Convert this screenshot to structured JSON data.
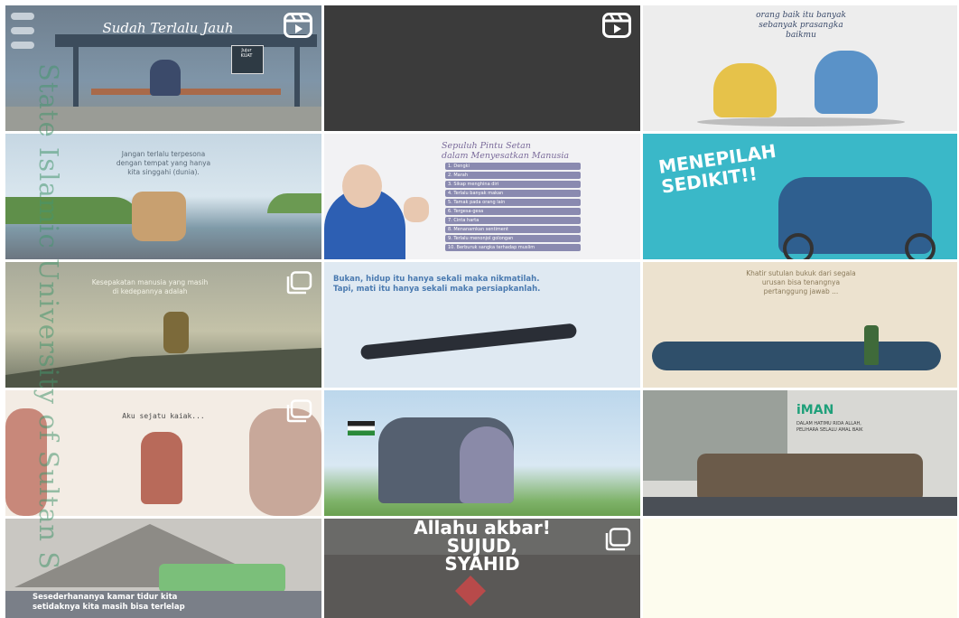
{
  "watermark": "State Islamic University of Sultan S",
  "tiles": [
    {
      "title": "Sudah Terlalu Jauh",
      "sign": "Jujur\nKUAT"
    },
    {},
    {
      "title": "orang baik itu banyak\nsebanyak prasangka\nbaikmu"
    },
    {
      "title": "Jangan terlalu terpesona\ndengan tempat yang hanya\nkita singgahi (dunia)."
    },
    {
      "title": "Sepuluh Pintu Setan\ndalam Menyesatkan Manusia",
      "items": [
        "1. Dengki",
        "2. Marah",
        "3. Sikap menghina diri",
        "4. Terlalu banyak makan",
        "5. Tamak pada orang lain",
        "6. Tergesa-gesa",
        "7. Cinta harta",
        "8. Menanamkan sentiment",
        "9. Terlalu menonjol golongan",
        "10. Berburuk sangka terhadap muslim"
      ]
    },
    {
      "title": "MENEPILAH\nSEDIKIT!!"
    },
    {
      "title": "Kesepakatan manusia yang masih\ndi kedepannya adalah"
    },
    {
      "title": "Bukan, hidup itu hanya sekali maka nikmatilah.\nTapi, mati itu hanya sekali maka persiapkanlah."
    },
    {
      "title": "Khatir sutulan bukuk dari segala\nurusan bisa tenangnya\npertanggung jawab ..."
    },
    {
      "title": "Aku sejatu kaiak..."
    },
    {},
    {
      "title": "iMAN",
      "sub": "DALAM HATIMU RIDA ALLAH,\nPELIHARA SELALU AMAL BAIK"
    },
    {
      "title": "Sesederhananya kamar tidur kita\nsetidaknya kita masih bisa terlelap"
    },
    {
      "title": "Allahu akbar!\nSUJUD,\nSYAHID"
    },
    {}
  ]
}
